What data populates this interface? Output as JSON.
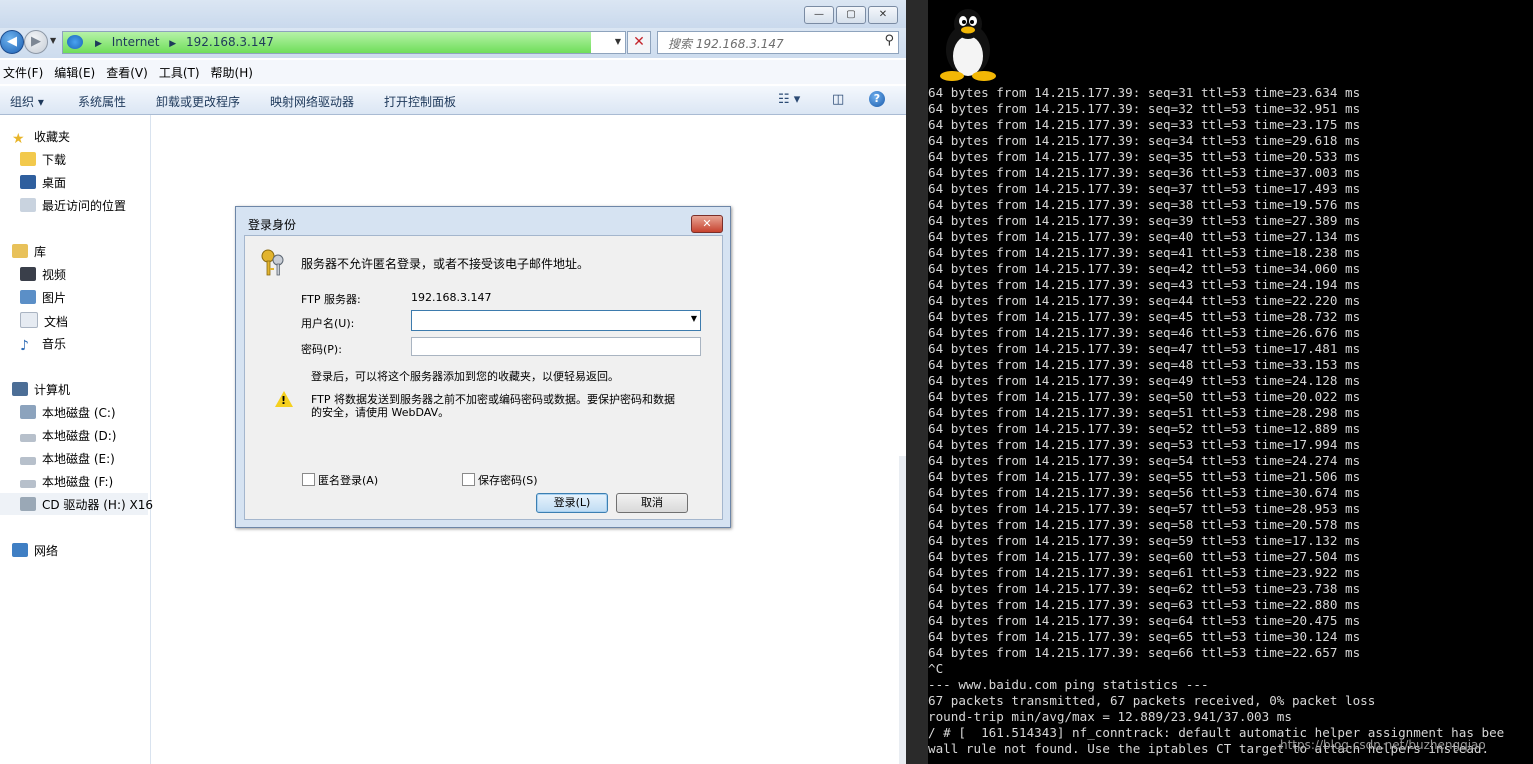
{
  "explorer": {
    "address": {
      "segments": [
        "Internet",
        "192.168.3.147"
      ]
    },
    "search": {
      "placeholder": "搜索 192.168.3.147"
    },
    "menu": [
      "文件(F)",
      "编辑(E)",
      "查看(V)",
      "工具(T)",
      "帮助(H)"
    ],
    "toolbar": {
      "organize": "组织 ▾",
      "system_properties": "系统属性",
      "uninstall": "卸载或更改程序",
      "map_drive": "映射网络驱动器",
      "control_panel": "打开控制面板"
    },
    "nav": {
      "favorites": "收藏夹",
      "downloads": "下载",
      "desktop": "桌面",
      "recent": "最近访问的位置",
      "libraries": "库",
      "videos": "视频",
      "pictures": "图片",
      "documents": "文档",
      "music": "音乐",
      "computer": "计算机",
      "disk_c": "本地磁盘 (C:)",
      "disk_d": "本地磁盘 (D:)",
      "disk_e": "本地磁盘 (E:)",
      "disk_f": "本地磁盘 (F:)",
      "cd": "CD 驱动器 (H:) X16",
      "network": "网络"
    },
    "window_buttons": {
      "minimize": "—",
      "maximize": "▢",
      "close": "✕"
    },
    "colors": {
      "address_fill": "#6fde5a",
      "toolbar_bg": "#dbe6f4"
    }
  },
  "dialog": {
    "title": "登录身份",
    "message": "服务器不允许匿名登录，或者不接受该电子邮件地址。",
    "ftp_server_label": "FTP 服务器:",
    "ftp_server_value": "192.168.3.147",
    "username_label": "用户名(U):",
    "username_value": "",
    "password_label": "密码(P):",
    "password_value": "",
    "hint": "登录后，可以将这个服务器添加到您的收藏夹，以便轻易返回。",
    "warning_line1": "FTP 将数据发送到服务器之前不加密或编码密码或数据。要保护密码和数据",
    "warning_line2": "的安全，请使用 WebDAV。",
    "anonymous_label": "匿名登录(A)",
    "save_password_label": "保存密码(S)",
    "anonymous_checked": false,
    "save_password_checked": false,
    "login_button": "登录(L)",
    "cancel_button": "取消"
  },
  "terminal": {
    "lines": [
      "64 bytes from 14.215.177.39: seq=31 ttl=53 time=23.634 ms",
      "64 bytes from 14.215.177.39: seq=32 ttl=53 time=32.951 ms",
      "64 bytes from 14.215.177.39: seq=33 ttl=53 time=23.175 ms",
      "64 bytes from 14.215.177.39: seq=34 ttl=53 time=29.618 ms",
      "64 bytes from 14.215.177.39: seq=35 ttl=53 time=20.533 ms",
      "64 bytes from 14.215.177.39: seq=36 ttl=53 time=37.003 ms",
      "64 bytes from 14.215.177.39: seq=37 ttl=53 time=17.493 ms",
      "64 bytes from 14.215.177.39: seq=38 ttl=53 time=19.576 ms",
      "64 bytes from 14.215.177.39: seq=39 ttl=53 time=27.389 ms",
      "64 bytes from 14.215.177.39: seq=40 ttl=53 time=27.134 ms",
      "64 bytes from 14.215.177.39: seq=41 ttl=53 time=18.238 ms",
      "64 bytes from 14.215.177.39: seq=42 ttl=53 time=34.060 ms",
      "64 bytes from 14.215.177.39: seq=43 ttl=53 time=24.194 ms",
      "64 bytes from 14.215.177.39: seq=44 ttl=53 time=22.220 ms",
      "64 bytes from 14.215.177.39: seq=45 ttl=53 time=28.732 ms",
      "64 bytes from 14.215.177.39: seq=46 ttl=53 time=26.676 ms",
      "64 bytes from 14.215.177.39: seq=47 ttl=53 time=17.481 ms",
      "64 bytes from 14.215.177.39: seq=48 ttl=53 time=33.153 ms",
      "64 bytes from 14.215.177.39: seq=49 ttl=53 time=24.128 ms",
      "64 bytes from 14.215.177.39: seq=50 ttl=53 time=20.022 ms",
      "64 bytes from 14.215.177.39: seq=51 ttl=53 time=28.298 ms",
      "64 bytes from 14.215.177.39: seq=52 ttl=53 time=12.889 ms",
      "64 bytes from 14.215.177.39: seq=53 ttl=53 time=17.994 ms",
      "64 bytes from 14.215.177.39: seq=54 ttl=53 time=24.274 ms",
      "64 bytes from 14.215.177.39: seq=55 ttl=53 time=21.506 ms",
      "64 bytes from 14.215.177.39: seq=56 ttl=53 time=30.674 ms",
      "64 bytes from 14.215.177.39: seq=57 ttl=53 time=28.953 ms",
      "64 bytes from 14.215.177.39: seq=58 ttl=53 time=20.578 ms",
      "64 bytes from 14.215.177.39: seq=59 ttl=53 time=17.132 ms",
      "64 bytes from 14.215.177.39: seq=60 ttl=53 time=27.504 ms",
      "64 bytes from 14.215.177.39: seq=61 ttl=53 time=23.922 ms",
      "64 bytes from 14.215.177.39: seq=62 ttl=53 time=23.738 ms",
      "64 bytes from 14.215.177.39: seq=63 ttl=53 time=22.880 ms",
      "64 bytes from 14.215.177.39: seq=64 ttl=53 time=20.475 ms",
      "64 bytes from 14.215.177.39: seq=65 ttl=53 time=30.124 ms",
      "64 bytes from 14.215.177.39: seq=66 ttl=53 time=22.657 ms",
      "^C",
      "--- www.baidu.com ping statistics ---",
      "67 packets transmitted, 67 packets received, 0% packet loss",
      "round-trip min/avg/max = 12.889/23.941/37.003 ms",
      "/ # [  161.514343] nf_conntrack: default automatic helper assignment has bee",
      "wall rule not found. Use the iptables CT target to attach helpers instead."
    ],
    "watermark": "https://blog.csdn.net/buzhengqiao"
  }
}
